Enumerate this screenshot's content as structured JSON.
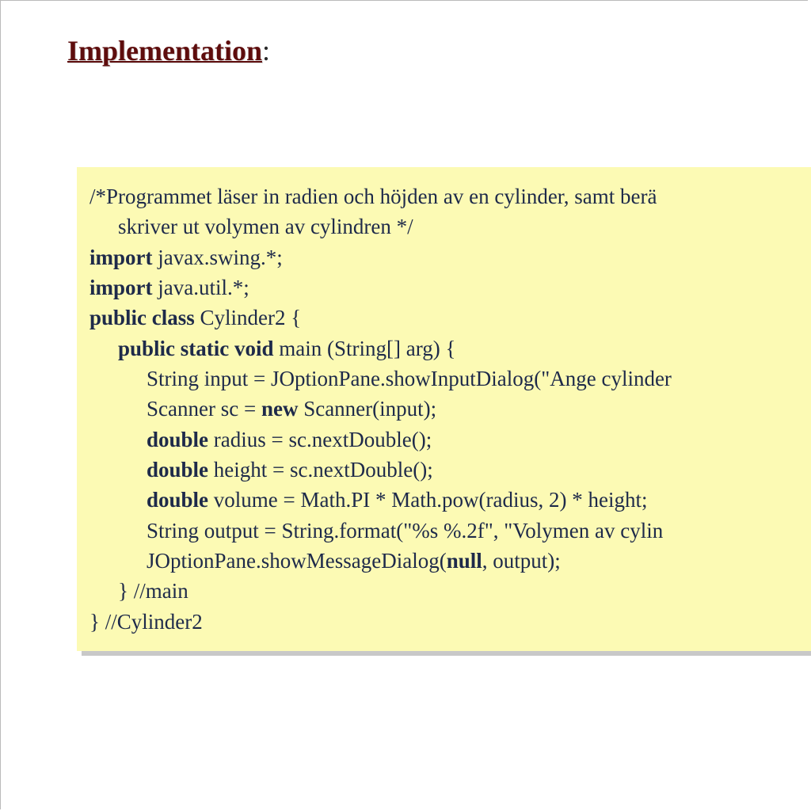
{
  "heading": {
    "title": "Implementation",
    "suffix": ":"
  },
  "code": {
    "lines": [
      {
        "indent": 0,
        "segments": [
          {
            "t": "/*Programmet läser in radien och höjden av en cylinder, samt berä"
          }
        ]
      },
      {
        "indent": 1,
        "segments": [
          {
            "t": "skriver ut volymen av cylindren */"
          }
        ]
      },
      {
        "indent": 0,
        "segments": [
          {
            "t": "import ",
            "kw": true
          },
          {
            "t": "javax.swing.*;"
          }
        ]
      },
      {
        "indent": 0,
        "segments": [
          {
            "t": "import ",
            "kw": true
          },
          {
            "t": "java.util.*;"
          }
        ]
      },
      {
        "indent": 0,
        "segments": [
          {
            "t": "public class ",
            "kw": true
          },
          {
            "t": "Cylinder2 {"
          }
        ]
      },
      {
        "indent": 1,
        "segments": [
          {
            "t": "public static void ",
            "kw": true
          },
          {
            "t": "main (String[] arg) {"
          }
        ]
      },
      {
        "indent": 2,
        "segments": [
          {
            "t": "String input = JOptionPane.showInputDialog(\"Ange cylinder"
          }
        ]
      },
      {
        "indent": 2,
        "segments": [
          {
            "t": "Scanner sc = "
          },
          {
            "t": "new ",
            "kw": true
          },
          {
            "t": "Scanner(input);"
          }
        ]
      },
      {
        "indent": 2,
        "segments": [
          {
            "t": "double ",
            "kw": true
          },
          {
            "t": "radius  = sc.nextDouble();"
          }
        ]
      },
      {
        "indent": 2,
        "segments": [
          {
            "t": "double ",
            "kw": true
          },
          {
            "t": "height = sc.nextDouble();"
          }
        ]
      },
      {
        "indent": 2,
        "segments": [
          {
            "t": "double ",
            "kw": true
          },
          {
            "t": "volume = Math.PI * Math.pow(radius, 2) * height;"
          }
        ]
      },
      {
        "indent": 2,
        "segments": [
          {
            "t": "String output = String.format(\"%s %.2f\", \"Volymen av cylin"
          }
        ]
      },
      {
        "indent": 2,
        "segments": [
          {
            "t": "JOptionPane.showMessageDialog("
          },
          {
            "t": "null",
            "kw": true
          },
          {
            "t": ", output);"
          }
        ]
      },
      {
        "indent": 1,
        "segments": [
          {
            "t": "} //main"
          }
        ]
      },
      {
        "indent": 0,
        "segments": [
          {
            "t": "} //Cylinder2"
          }
        ]
      }
    ]
  }
}
